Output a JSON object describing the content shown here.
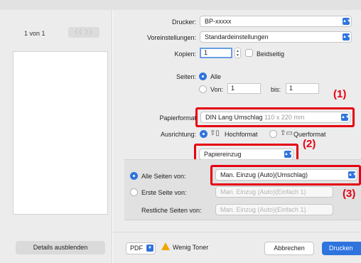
{
  "preview": {
    "page_count": "1 von 1",
    "nav_arrows": "〈〈 〉〉",
    "hide_details": "Details ausblenden"
  },
  "printer": {
    "label": "Drucker:",
    "value": "BP-xxxxx"
  },
  "presets": {
    "label": "Voreinstellungen:",
    "value": "Standardeinstellungen"
  },
  "copies": {
    "label": "Kopien:",
    "value": "1",
    "duplex_label": "Beidseitig"
  },
  "pages": {
    "label": "Seiten:",
    "all_label": "Alle",
    "from_label": "Von:",
    "from_value": "1",
    "to_label": "bis:",
    "to_value": "1"
  },
  "paper_format": {
    "label": "Papierformat",
    "value": "DIN Lang Umschlag",
    "size": "110 x 220 mm"
  },
  "orientation": {
    "label": "Ausrichtung:",
    "portrait": "Hochformat",
    "landscape": "Querformat"
  },
  "section_menu": {
    "value": "Papiereinzug"
  },
  "paper_feed": {
    "all_pages_label": "Alle Seiten von:",
    "all_pages_value": "Man. Einzug (Auto)(Umschlag)",
    "first_page_label": "Erste Seite von:",
    "first_page_value": "Man. Einzug (Auto)(Einfach 1)",
    "remaining_label": "Restliche Seiten von:",
    "remaining_value": "Man. Einzug (Auto)(Einfach 1)"
  },
  "markers": {
    "m1": "(1)",
    "m2": "(2)",
    "m3": "(3)"
  },
  "footer": {
    "pdf_label": "PDF",
    "warning": "Wenig Toner",
    "cancel": "Abbrechen",
    "print": "Drucken"
  },
  "colors": {
    "accent": "#2f74de",
    "highlight": "#e60012",
    "warning": "#f0a500"
  },
  "icons": {
    "chevron": "chevron-updown-icon",
    "warning": "warning-triangle-icon",
    "portrait": "portrait-orientation-icon",
    "landscape": "landscape-orientation-icon"
  }
}
